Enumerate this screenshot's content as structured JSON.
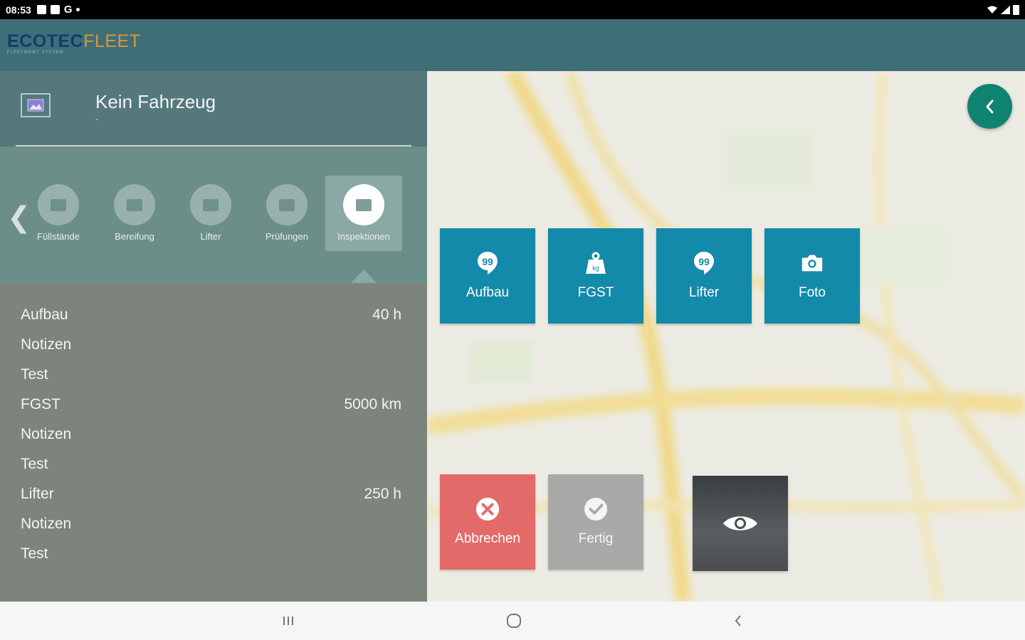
{
  "status": {
    "time": "08:53",
    "icons": [
      "image-icon",
      "calendar-icon",
      "google-icon",
      "dot-icon"
    ],
    "right_icons": [
      "wifi-icon",
      "signal-icon",
      "battery-icon"
    ]
  },
  "app": {
    "logo_part1": "ECOTEC",
    "logo_part2": "FLEET",
    "logo_sub": "FLEETMGMT SYSTEM"
  },
  "vehicle": {
    "title": "Kein Fahrzeug",
    "subtitle": "-"
  },
  "tabs": [
    {
      "label": "Füllstände",
      "active": false
    },
    {
      "label": "Bereifung",
      "active": false
    },
    {
      "label": "Lifter",
      "active": false
    },
    {
      "label": "Prüfungen",
      "active": false
    },
    {
      "label": "Inspektionen",
      "active": true
    }
  ],
  "list": [
    {
      "label": "Aufbau",
      "value": "40 h"
    },
    {
      "label": "Notizen",
      "value": ""
    },
    {
      "label": "Test",
      "value": ""
    },
    {
      "label": "FGST",
      "value": "5000 km"
    },
    {
      "label": "Notizen",
      "value": ""
    },
    {
      "label": "Test",
      "value": ""
    },
    {
      "label": "Lifter",
      "value": "250 h"
    },
    {
      "label": "Notizen",
      "value": ""
    },
    {
      "label": "Test",
      "value": ""
    }
  ],
  "actions": [
    {
      "label": "Aufbau",
      "icon": "quote-bubble-icon"
    },
    {
      "label": "FGST",
      "icon": "weight-icon"
    },
    {
      "label": "Lifter",
      "icon": "quote-bubble-icon"
    },
    {
      "label": "Foto",
      "icon": "camera-icon"
    }
  ],
  "bottom": {
    "cancel": "Abbrechen",
    "done": "Fertig"
  },
  "colors": {
    "teal": "#138aa9",
    "accent_green": "#0e8370",
    "cancel_red": "#e46a6a",
    "header": "#3e6f79"
  }
}
